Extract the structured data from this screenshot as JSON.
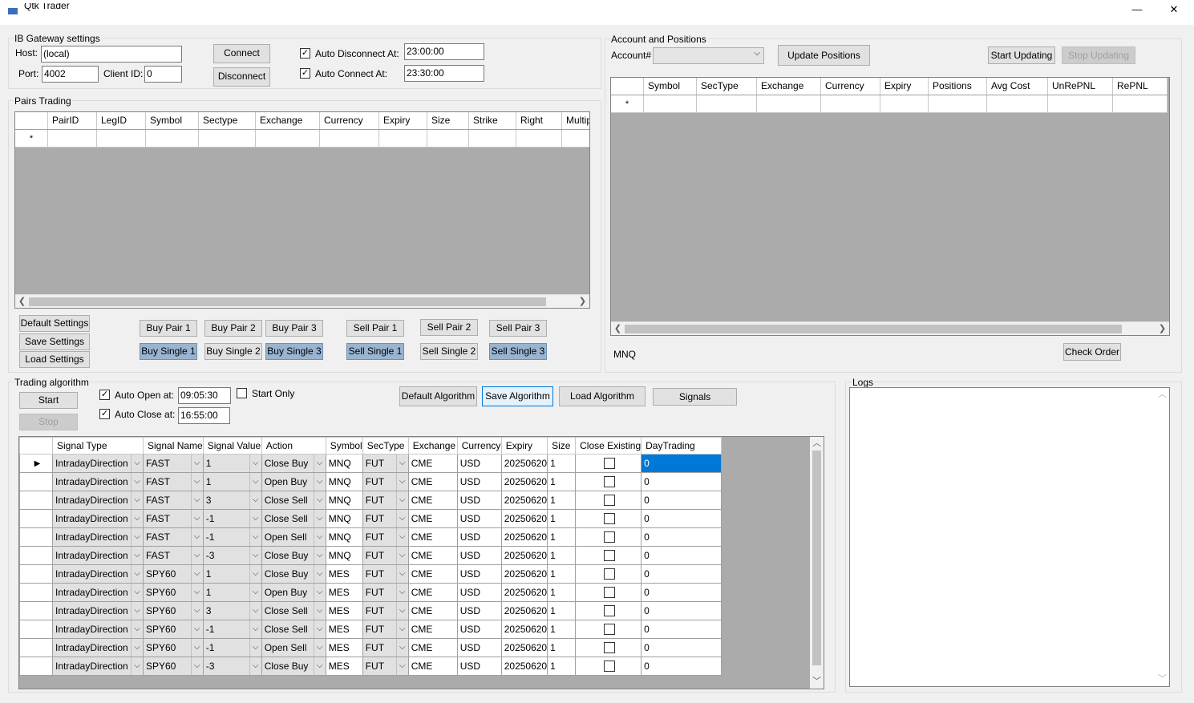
{
  "window": {
    "title": "Qtk Trader",
    "minimize_glyph": "—",
    "close_glyph": "✕"
  },
  "ib": {
    "group_label": "IB Gateway settings",
    "host_label": "Host:",
    "host_value": "(local)",
    "port_label": "Port:",
    "port_value": "4002",
    "client_label": "Client ID:",
    "client_value": "0",
    "connect": "Connect",
    "disconnect": "Disconnect",
    "auto_disconnect_label": "Auto Disconnect At:",
    "auto_disconnect_value": "23:00:00",
    "auto_connect_label": "Auto Connect At:",
    "auto_connect_value": "23:30:00"
  },
  "pairs": {
    "group_label": "Pairs Trading",
    "columns": [
      "PairID",
      "LegID",
      "Symbol",
      "Sectype",
      "Exchange",
      "Currency",
      "Expiry",
      "Size",
      "Strike",
      "Right",
      "Multip"
    ],
    "new_row_marker": "*",
    "buttons": {
      "default_settings": "Default Settings",
      "save_settings": "Save Settings",
      "load_settings": "Load Settings",
      "buy_pair_1": "Buy Pair 1",
      "buy_pair_2": "Buy Pair 2",
      "buy_pair_3": "Buy Pair 3",
      "sell_pair_1": "Sell Pair 1",
      "sell_pair_2": "Sell Pair 2",
      "sell_pair_3": "Sell Pair 3",
      "buy_single_1": "Buy Single 1",
      "buy_single_2": "Buy Single 2",
      "buy_single_3": "Buy Single 3",
      "sell_single_1": "Sell Single 1",
      "sell_single_2": "Sell Single 2",
      "sell_single_3": "Sell Single 3"
    }
  },
  "account": {
    "group_label": "Account and Positions",
    "account_label": "Account#",
    "account_value": "",
    "update_positions": "Update Positions",
    "start_updating": "Start Updating",
    "stop_updating": "Stop Updating",
    "columns": [
      "Symbol",
      "SecType",
      "Exchange",
      "Currency",
      "Expiry",
      "Positions",
      "Avg Cost",
      "UnRePNL",
      "RePNL"
    ],
    "new_row_marker": "*",
    "symbol_text": "MNQ",
    "check_order": "Check Order"
  },
  "algo": {
    "group_label": "Trading algorithm",
    "start": "Start",
    "stop": "Stop",
    "auto_open_label": "Auto Open at:",
    "auto_open_value": "09:05:30",
    "auto_close_label": "Auto Close at:",
    "auto_close_value": "16:55:00",
    "start_only_label": "Start Only",
    "default_algorithm": "Default Algorithm",
    "save_algorithm": "Save Algorithm",
    "load_algorithm": "Load Algorithm",
    "signals": "Signals",
    "columns": [
      "Signal Type",
      "Signal Name",
      "Signal Value",
      "Action",
      "Symbol",
      "SecType",
      "Exchange",
      "Currency",
      "Expiry",
      "Size",
      "Close Existing",
      "DayTrading"
    ],
    "rows": [
      {
        "type": "IntradayDirection",
        "name": "FAST",
        "value": "1",
        "action": "Close Buy",
        "symbol": "MNQ",
        "sectype": "FUT",
        "exchange": "CME",
        "currency": "USD",
        "expiry": "20250620",
        "size": "1",
        "close": false,
        "day": "0"
      },
      {
        "type": "IntradayDirection",
        "name": "FAST",
        "value": "1",
        "action": "Open Buy",
        "symbol": "MNQ",
        "sectype": "FUT",
        "exchange": "CME",
        "currency": "USD",
        "expiry": "20250620",
        "size": "1",
        "close": false,
        "day": "0"
      },
      {
        "type": "IntradayDirection",
        "name": "FAST",
        "value": "3",
        "action": "Close Sell",
        "symbol": "MNQ",
        "sectype": "FUT",
        "exchange": "CME",
        "currency": "USD",
        "expiry": "20250620",
        "size": "1",
        "close": false,
        "day": "0"
      },
      {
        "type": "IntradayDirection",
        "name": "FAST",
        "value": "-1",
        "action": "Close Sell",
        "symbol": "MNQ",
        "sectype": "FUT",
        "exchange": "CME",
        "currency": "USD",
        "expiry": "20250620",
        "size": "1",
        "close": false,
        "day": "0"
      },
      {
        "type": "IntradayDirection",
        "name": "FAST",
        "value": "-1",
        "action": "Open Sell",
        "symbol": "MNQ",
        "sectype": "FUT",
        "exchange": "CME",
        "currency": "USD",
        "expiry": "20250620",
        "size": "1",
        "close": false,
        "day": "0"
      },
      {
        "type": "IntradayDirection",
        "name": "FAST",
        "value": "-3",
        "action": "Close Buy",
        "symbol": "MNQ",
        "sectype": "FUT",
        "exchange": "CME",
        "currency": "USD",
        "expiry": "20250620",
        "size": "1",
        "close": false,
        "day": "0"
      },
      {
        "type": "IntradayDirection",
        "name": "SPY60",
        "value": "1",
        "action": "Close Buy",
        "symbol": "MES",
        "sectype": "FUT",
        "exchange": "CME",
        "currency": "USD",
        "expiry": "20250620",
        "size": "1",
        "close": false,
        "day": "0"
      },
      {
        "type": "IntradayDirection",
        "name": "SPY60",
        "value": "1",
        "action": "Open Buy",
        "symbol": "MES",
        "sectype": "FUT",
        "exchange": "CME",
        "currency": "USD",
        "expiry": "20250620",
        "size": "1",
        "close": false,
        "day": "0"
      },
      {
        "type": "IntradayDirection",
        "name": "SPY60",
        "value": "3",
        "action": "Close Sell",
        "symbol": "MES",
        "sectype": "FUT",
        "exchange": "CME",
        "currency": "USD",
        "expiry": "20250620",
        "size": "1",
        "close": false,
        "day": "0"
      },
      {
        "type": "IntradayDirection",
        "name": "SPY60",
        "value": "-1",
        "action": "Close Sell",
        "symbol": "MES",
        "sectype": "FUT",
        "exchange": "CME",
        "currency": "USD",
        "expiry": "20250620",
        "size": "1",
        "close": false,
        "day": "0"
      },
      {
        "type": "IntradayDirection",
        "name": "SPY60",
        "value": "-1",
        "action": "Open Sell",
        "symbol": "MES",
        "sectype": "FUT",
        "exchange": "CME",
        "currency": "USD",
        "expiry": "20250620",
        "size": "1",
        "close": false,
        "day": "0"
      },
      {
        "type": "IntradayDirection",
        "name": "SPY60",
        "value": "-3",
        "action": "Close Buy",
        "symbol": "MES",
        "sectype": "FUT",
        "exchange": "CME",
        "currency": "USD",
        "expiry": "20250620",
        "size": "1",
        "close": false,
        "day": "0"
      }
    ]
  },
  "logs": {
    "group_label": "Logs"
  },
  "colors": {
    "selection": "#0078d7",
    "grid_background": "#ababab",
    "toggle_selected": "#99b4d1"
  }
}
